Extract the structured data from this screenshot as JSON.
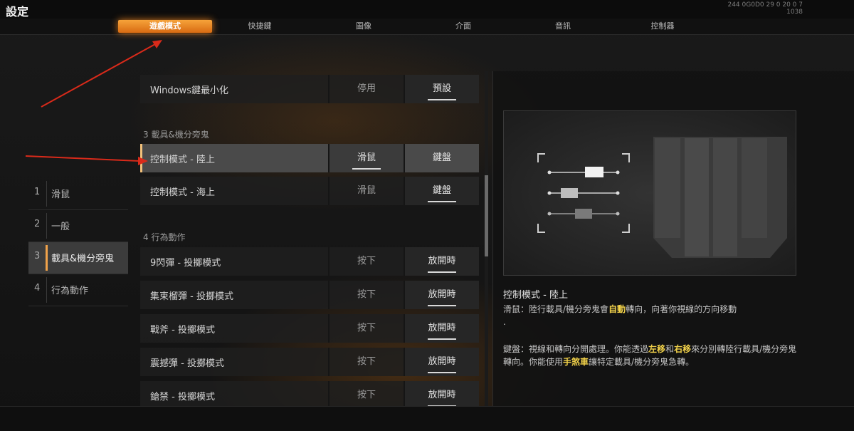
{
  "window": {
    "title": "設定",
    "sysinfo_line1": "244 0G0D0 29 0 20 0 7",
    "sysinfo_line2": "1038"
  },
  "tabs": [
    {
      "label": "遊戲模式",
      "active": true
    },
    {
      "label": "快捷鍵",
      "active": false
    },
    {
      "label": "圖像",
      "active": false
    },
    {
      "label": "介面",
      "active": false
    },
    {
      "label": "音訊",
      "active": false
    },
    {
      "label": "控制器",
      "active": false
    }
  ],
  "sidebar": {
    "items": [
      {
        "num": "1",
        "label": "滑鼠",
        "active": false
      },
      {
        "num": "2",
        "label": "一般",
        "active": false
      },
      {
        "num": "3",
        "label": "載具&機分旁鬼",
        "active": true
      },
      {
        "num": "4",
        "label": "行為動作",
        "active": false
      }
    ]
  },
  "settings": {
    "row_windows": {
      "label": "Windows鍵最小化",
      "opt1": "停用",
      "opt2": "預設",
      "selected": 2
    },
    "section3": "3 載具&機分旁鬼",
    "row_land": {
      "label": "控制模式 - 陸上",
      "opt1": "滑鼠",
      "opt2": "鍵盤",
      "selected": 1
    },
    "row_sea": {
      "label": "控制模式 - 海上",
      "opt1": "滑鼠",
      "opt2": "鍵盤",
      "selected": 2
    },
    "section4": "4 行為動作",
    "row_9": {
      "label": "9閃彈 - 投擲模式",
      "opt1": "按下",
      "opt2": "放開時",
      "selected": 2
    },
    "row_cluster": {
      "label": "集束榴彈 - 投擲模式",
      "opt1": "按下",
      "opt2": "放開時",
      "selected": 2
    },
    "row_axe": {
      "label": "戰斧 - 投擲模式",
      "opt1": "按下",
      "opt2": "放開時",
      "selected": 2
    },
    "row_shock": {
      "label": "震撼彈 - 投擲模式",
      "opt1": "按下",
      "opt2": "放開時",
      "selected": 2
    },
    "row_last": {
      "label": "鎗禁 - 投擲模式",
      "opt1": "按下",
      "opt2": "放開時",
      "selected": 2
    }
  },
  "info": {
    "title": "控制模式 - 陸上",
    "mouse_prefix": "滑鼠：",
    "mouse_text_a": "陸行載具/機分旁鬼會",
    "mouse_highlight": "自動",
    "mouse_text_b": "轉向，向著你視線的方向移動",
    "mouse_tail": ".",
    "kb_prefix": "鍵盤：",
    "kb_text_a": "視線和轉向分開處理。你能透過",
    "kb_hl1": "左移",
    "kb_text_b": "和",
    "kb_hl2": "右移",
    "kb_text_c": "來分別轉陸行載具/機分旁鬼轉向。你能使用",
    "kb_hl3": "手煞車",
    "kb_text_d": "讓特定載具/機分旁鬼急轉。"
  },
  "colors": {
    "accent": "#f2a340",
    "highlight_text": "#f2d24a",
    "arrow": "#d92a1a"
  }
}
